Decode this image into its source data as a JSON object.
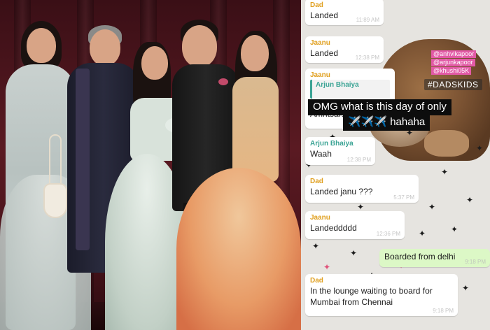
{
  "chat": {
    "messages": [
      {
        "sender": "Dad",
        "text": "Landed",
        "time": "11:89 AM"
      },
      {
        "sender": "Jaanu",
        "text": "Landed",
        "time": "12:38 PM"
      },
      {
        "sender": "Jaanu",
        "quote_sender": "Arjun Bhaiya",
        "text": "Amritsar!"
      },
      {
        "sender": "Arjun Bhaiya",
        "text": "Waah",
        "time": "12:38 PM"
      },
      {
        "sender": "Dad",
        "text": "Landed janu ???",
        "time": "5:37 PM"
      },
      {
        "sender": "Jaanu",
        "text": "Landeddddd",
        "time": "12:36 PM"
      },
      {
        "text": "Boarded from delhi",
        "time": "9:18 PM"
      },
      {
        "sender": "Dad",
        "text": "In the lounge waiting to board for Mumbai from Chennai",
        "time": "9:18 PM"
      }
    ]
  },
  "overlays": {
    "tags": [
      "@anhvikapoor",
      "@arjunkapoor",
      "@khushi05K"
    ],
    "hashtag": "#DADSKIDS",
    "caption_line1": "OMG what is this day of only",
    "caption_line2": "✈️✈️✈️ hahaha"
  },
  "colors": {
    "backdrop": "#5a1a22",
    "dad_sender": "#e0a020",
    "teal_sender": "#3aa394",
    "outgoing_bubble": "#dcf8c6",
    "tag_pink": "#e25aa6"
  }
}
